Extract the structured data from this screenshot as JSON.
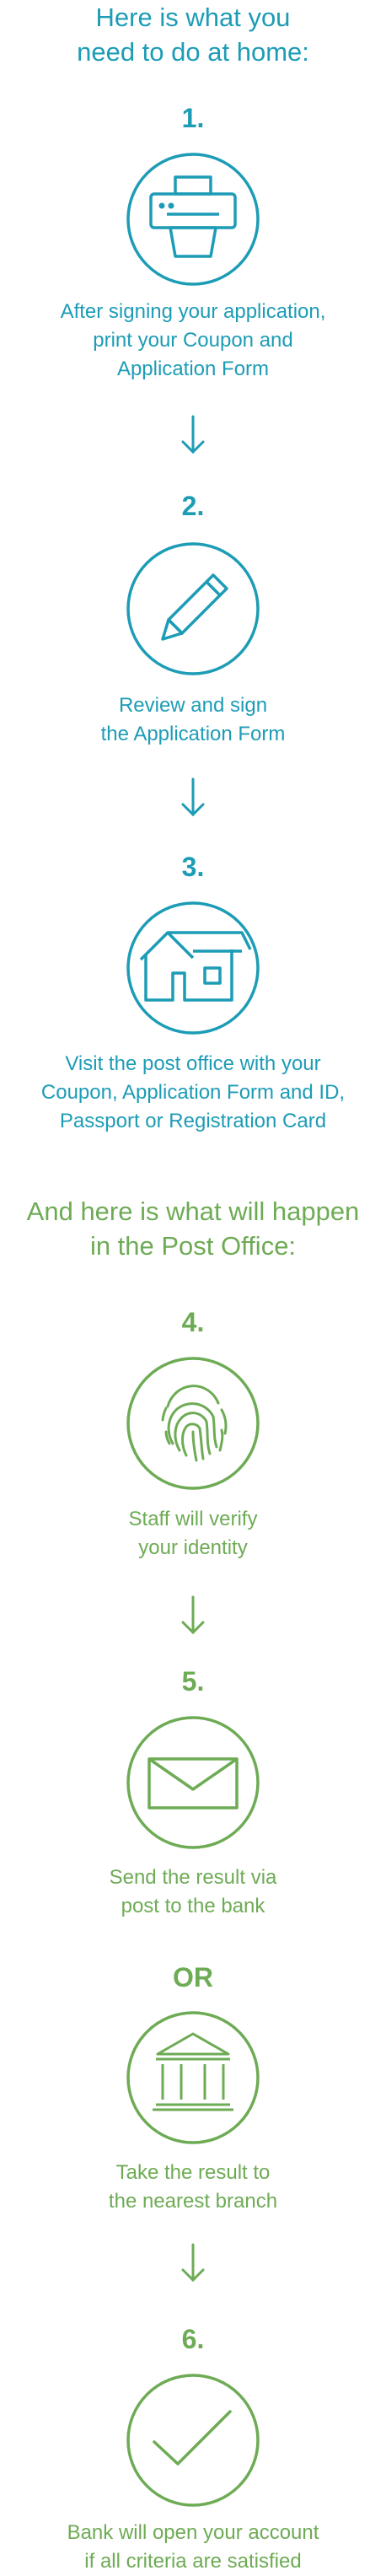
{
  "home_section": {
    "heading_line1": "Here is what you",
    "heading_line2": "need to do at home:"
  },
  "steps": [
    {
      "number": "1.",
      "icon": "printer-icon",
      "caption_lines": [
        "After signing your application,",
        "print your Coupon and",
        "Application Form"
      ]
    },
    {
      "number": "2.",
      "icon": "pencil-icon",
      "caption_lines": [
        "Review and sign",
        "the Application Form"
      ]
    },
    {
      "number": "3.",
      "icon": "house-icon",
      "caption_lines": [
        "Visit the post office with your",
        "Coupon, Application Form and ID,",
        "Passport or Registration Card"
      ]
    },
    {
      "number": "4.",
      "icon": "fingerprint-icon",
      "caption_lines": [
        "Staff will verify",
        "your identity"
      ]
    },
    {
      "number": "5.",
      "icon": "envelope-icon",
      "caption_lines": [
        "Send the result via",
        "post to the bank"
      ],
      "or_label": "OR",
      "alt_icon": "bank-building-icon",
      "alt_caption_lines": [
        "Take the result to",
        "the nearest branch"
      ]
    },
    {
      "number": "6.",
      "icon": "checkmark-icon",
      "caption_lines": [
        "Bank will open your account",
        "if all criteria are satisfied"
      ]
    }
  ],
  "post_office_section": {
    "heading_line1": "And here is what will happen",
    "heading_line2": "in the Post Office:"
  },
  "colors": {
    "teal": "#1d9cb6",
    "green": "#6eab55"
  }
}
